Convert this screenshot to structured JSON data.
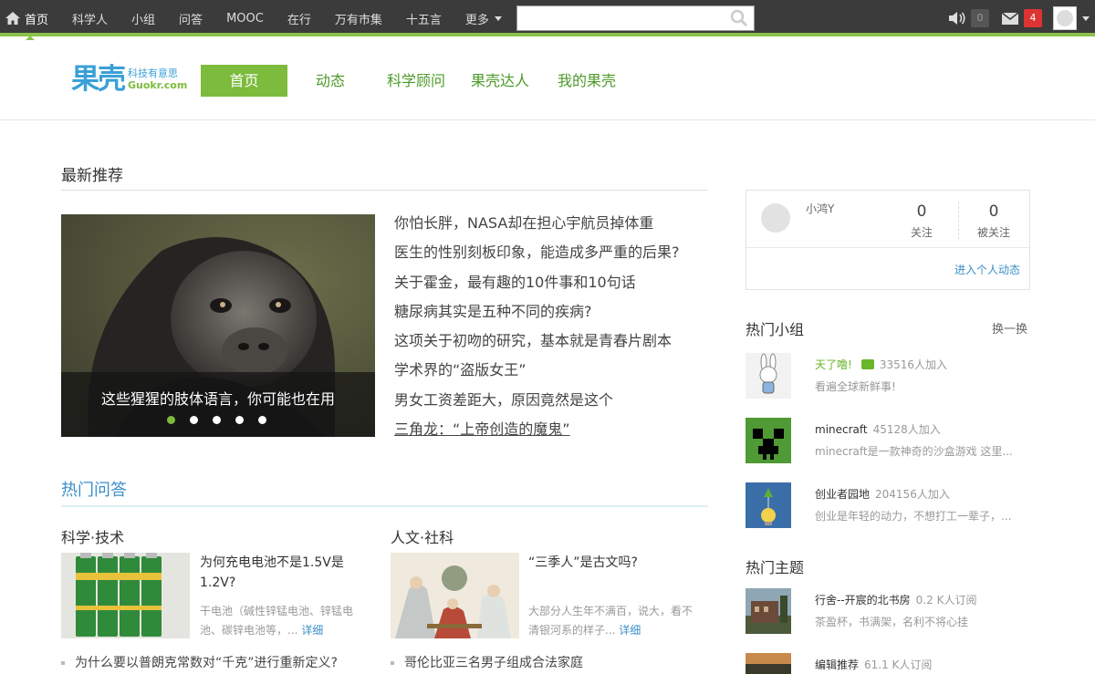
{
  "topbar": {
    "nav": [
      {
        "label": "首页",
        "active": true
      },
      {
        "label": "科学人"
      },
      {
        "label": "小组"
      },
      {
        "label": "问答"
      },
      {
        "label": "MOOC"
      },
      {
        "label": "在行"
      },
      {
        "label": "万有市集"
      },
      {
        "label": "十五言"
      },
      {
        "label": "更多"
      }
    ],
    "search_placeholder": "",
    "notices_count": "0",
    "messages_count": "4"
  },
  "header": {
    "logo_mark": "果壳",
    "logo_cn": "科技有意思",
    "logo_en": "Guokr.com",
    "nav": [
      "首页",
      "动态",
      "科学顾问",
      "果壳达人",
      "我的果壳"
    ]
  },
  "latest": {
    "title": "最新推荐",
    "slide_caption": "这些猩猩的肢体语言，你可能也在用",
    "dots_total": 5,
    "dots_active": 1,
    "items": [
      "你怕长胖，NASA却在担心宇航员掉体重",
      "医生的性别刻板印象，能造成多严重的后果?",
      "关于霍金，最有趣的10件事和10句话",
      "糖尿病其实是五种不同的疾病?",
      "这项关于初吻的研究，基本就是青春片剧本",
      "学术界的“盗版女王”",
      "男女工资差距大，原因竟然是这个",
      "三角龙：“上帝创造的魔鬼”"
    ]
  },
  "qa": {
    "title": "热门问答",
    "science": {
      "title": "科学·技术",
      "q_title": "为何充电电池不是1.5V是1.2V?",
      "q_desc": "干电池（碱性锌锰电池、锌锰电池、碳锌电池等，...",
      "more": "详细",
      "bullet": "为什么要以普朗克常数对“千克”进行重新定义?"
    },
    "humanity": {
      "title": "人文·社科",
      "q_title": "“三季人”是古文吗?",
      "q_desc": "大部分人生年不满百，说大，看不清银河系的样子...",
      "more": "详细",
      "bullet": "哥伦比亚三名男子组成合法家庭"
    }
  },
  "user_card": {
    "name": "小鸿Y",
    "following": "0",
    "following_label": "关注",
    "followers": "0",
    "followers_label": "被关注",
    "link": "进入个人动态"
  },
  "hot_groups": {
    "title": "热门小组",
    "switch": "换一换",
    "items": [
      {
        "name": "天了噜!",
        "count": "33516人加入",
        "desc": "看遍全球新鲜事!",
        "highlight": true
      },
      {
        "name": "minecraft",
        "count": "45128人加入",
        "desc": "minecraft是一款神奇的沙盒游戏 这里..."
      },
      {
        "name": "创业者园地",
        "count": "204156人加入",
        "desc": "创业是年轻的动力，不想打工一辈子，..."
      }
    ]
  },
  "hot_topics": {
    "title": "热门主题",
    "items": [
      {
        "name": "行舍--开宸的北书房",
        "count": "0.2 K人订阅",
        "desc": "茶盈杯，书满架，名利不将心挂"
      },
      {
        "name": "编辑推荐",
        "count": "61.1 K人订阅",
        "desc": ""
      }
    ]
  },
  "colors": {
    "green": "#7dbb3c",
    "blue": "#3a8fc9",
    "topbar": "#3b3b3b",
    "badge_red": "#d33"
  }
}
